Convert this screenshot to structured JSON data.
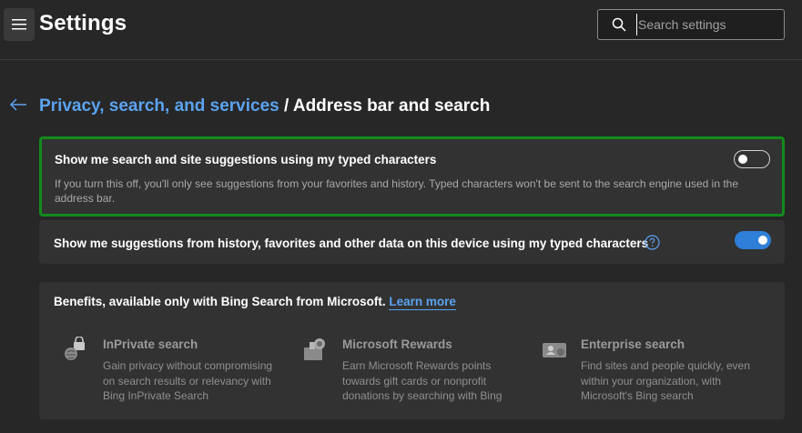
{
  "header": {
    "menu_icon": "hamburger-icon",
    "title": "Settings",
    "search": {
      "placeholder": "Search settings",
      "value": "",
      "icon": "search-icon"
    }
  },
  "breadcrumb": {
    "back_icon": "back-arrow-icon",
    "parent": "Privacy, search, and services",
    "separator": " / ",
    "current": "Address bar and search"
  },
  "settings": [
    {
      "title": "Show me search and site suggestions using my typed characters",
      "description": "If you turn this off, you'll only see suggestions from your favorites and history. Typed characters won't be sent to the search engine used in the address bar.",
      "enabled": false,
      "highlighted": true
    },
    {
      "title": "Show me suggestions from history, favorites and other data on this device using my typed characters",
      "help_icon": "question-circle-icon",
      "enabled": true
    }
  ],
  "benefits": {
    "title": "Benefits, available only with Bing Search from Microsoft.",
    "link": "Learn more",
    "items": [
      {
        "icon": "inprivate-lock-icon",
        "title": "InPrivate search",
        "description": "Gain privacy without compromising on search results or relevancy with Bing InPrivate Search"
      },
      {
        "icon": "rewards-trophy-icon",
        "title": "Microsoft Rewards",
        "description": "Earn Microsoft Rewards points towards gift cards or nonprofit donations by searching with Bing"
      },
      {
        "icon": "enterprise-id-icon",
        "title": "Enterprise search",
        "description": "Find sites and people quickly, even within your organization, with Microsoft's Bing search"
      }
    ]
  },
  "colors": {
    "background": "#272727",
    "card": "#323232",
    "accent": "#5ba3f0",
    "toggle_on": "#2f7fd8",
    "highlight_border": "#138a1c"
  }
}
